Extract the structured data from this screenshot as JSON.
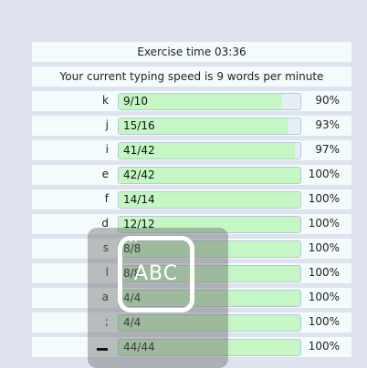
{
  "header": {
    "exercise_time": "Exercise time 03:36",
    "typing_speed": "Your current typing speed is 9 words per minute"
  },
  "rows": [
    {
      "key": "k",
      "score": "9/10",
      "fill": 0.9,
      "percent": "90%"
    },
    {
      "key": "j",
      "score": "15/16",
      "fill": 0.93,
      "percent": "93%"
    },
    {
      "key": "i",
      "score": "41/42",
      "fill": 0.97,
      "percent": "97%"
    },
    {
      "key": "e",
      "score": "42/42",
      "fill": 1.0,
      "percent": "100%"
    },
    {
      "key": "f",
      "score": "14/14",
      "fill": 1.0,
      "percent": "100%"
    },
    {
      "key": "d",
      "score": "12/12",
      "fill": 1.0,
      "percent": "100%"
    },
    {
      "key": "s",
      "score": "8/8",
      "fill": 1.0,
      "percent": "100%"
    },
    {
      "key": "l",
      "score": "8/8",
      "fill": 1.0,
      "percent": "100%"
    },
    {
      "key": "a",
      "score": "4/4",
      "fill": 1.0,
      "percent": "100%"
    },
    {
      "key": ";",
      "score": "4/4",
      "fill": 1.0,
      "percent": "100%"
    },
    {
      "key": "",
      "score": "44/44",
      "fill": 1.0,
      "percent": "100%"
    }
  ],
  "overlay": {
    "icon": "keyboard-input-icon",
    "icon_text": "ABC"
  },
  "colors": {
    "background": "#dfe3ef",
    "row_background": "#f3fbfd",
    "bar_fill": "#c4f7c4",
    "bar_track": "#e6eef5"
  }
}
